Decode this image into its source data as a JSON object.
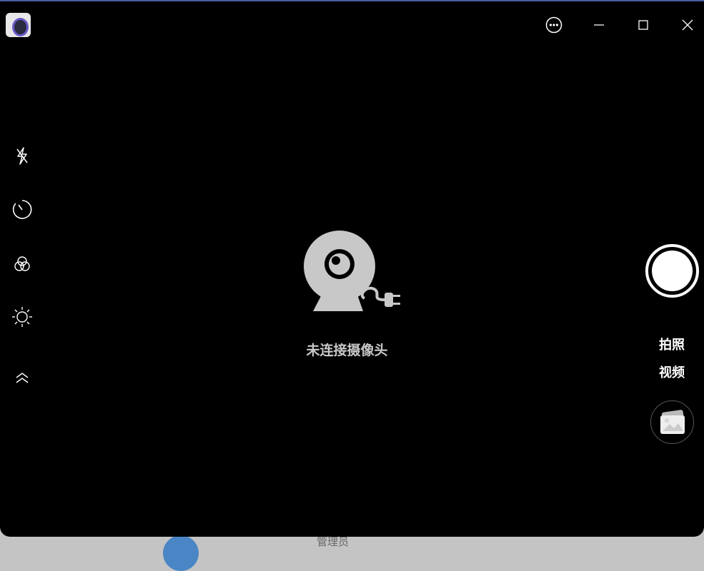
{
  "window": {
    "title_icon": "camera-app-icon"
  },
  "titlebar": {
    "menu": "more-icon",
    "minimize": "minimize-icon",
    "maximize": "maximize-icon",
    "close": "close-icon"
  },
  "sidebar": [
    "flash-off-icon",
    "timer-icon",
    "filter-icon",
    "brightness-icon",
    "expand-up-icon"
  ],
  "main": {
    "status": "未连接摄像头"
  },
  "controls": {
    "photo_label": "拍照",
    "video_label": "视频"
  },
  "background": {
    "user_label": "管理员"
  },
  "colors": {
    "border": "#4b5a9e",
    "text": "#c8c8c8"
  }
}
